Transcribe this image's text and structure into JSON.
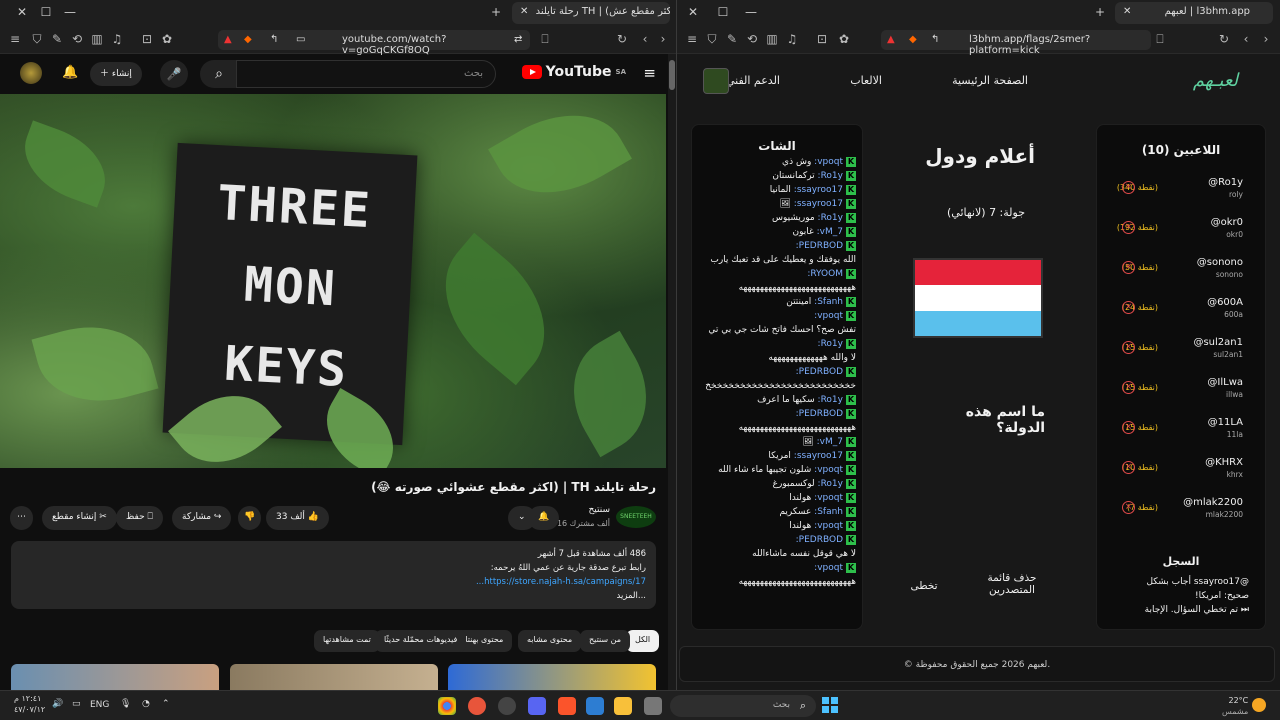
{
  "left_window": {
    "tab_title": "رحلة تايلند TH | (اكثر مقطع عش...",
    "url": "youtube.com/watch?v=goGqCKGf8OQ",
    "youtube": {
      "logo_text": "YouTube",
      "region": "SA",
      "search_placeholder": "بحث",
      "create_label": "إنشاء",
      "video": {
        "sign_lines": [
          "THREE",
          "MON",
          "KEYS"
        ],
        "title": "رحلة تايلند TH | (اكثر مقطع عشوائي صورته 😂)",
        "channel_name": "سنتيح",
        "channel_avatar_text": "SNEETEEH",
        "subscribers": "616 ألف مشترك",
        "likes": "33 ألف",
        "share_label": "مشاركة",
        "save_label": "حفظ",
        "clip_label": "إنشاء مقطع",
        "views_line": "486 ألف مشاهدة قبل 7 أشهر",
        "desc_line": "رابط تبرع صدقة جارية عن عمي اللهُ يرحمه:",
        "desc_link": "https://store.najah-h.sa/campaigns/17...",
        "more": "...المزيد"
      },
      "chips": [
        "الكل",
        "من سنتيح",
        "محتوى مشابه",
        "محتوى بهنتك",
        "فيديوهات محمّلة حديثًا",
        "تمت مشاهدتها"
      ]
    }
  },
  "right_window": {
    "tab_title": "لعبهم | l3bhm.app",
    "url": "l3bhm.app/flags/2smer?platform=kick",
    "app": {
      "logo": "لعبـهم",
      "nav": [
        "الصفحة الرئيسية",
        "الالعاب",
        "الدعم الفني"
      ],
      "players_title": "اللاعبين (10)",
      "players": [
        {
          "name": "@Ro1y",
          "handle": "roly",
          "points": "(340 نقطة)"
        },
        {
          "name": "@okr0",
          "handle": "okr0",
          "points": "(192 نقطة)"
        },
        {
          "name": "@sonono",
          "handle": "sonono",
          "points": "(50 نقطة)"
        },
        {
          "name": "@600A",
          "handle": "600a",
          "points": "(24 نقطة)"
        },
        {
          "name": "@sul2an1",
          "handle": "sul2an1",
          "points": "(15 نقطة)"
        },
        {
          "name": "@IlLwa",
          "handle": "illwa",
          "points": "(15 نقطة)"
        },
        {
          "name": "@11LA",
          "handle": "11la",
          "points": "(15 نقطة)"
        },
        {
          "name": "@KHRX",
          "handle": "khrx",
          "points": "(10 نقطة)"
        },
        {
          "name": "@mlak2200",
          "handle": "mlak2200",
          "points": "(7 نقطة)"
        }
      ],
      "log_title": "السجل",
      "log_lines": [
        "@ssayroo17 أجاب بشكل",
        "صحيح: امريكا!",
        "⏭ تم تخطي السؤال. الإجابة"
      ],
      "game_title": "أعلام ودول",
      "round": "جولة: 7 (لانهائي)",
      "flag_colors": [
        "#e5233a",
        "#ffffff",
        "#5ac0ec"
      ],
      "question": "ما اسم هذه الدولة؟",
      "leaderboard_button": "حذف قائمة المتصدرين",
      "skip_button": "تخطى",
      "chat_title": "الشات",
      "chat": [
        {
          "user": "vpoqt:",
          "text": "وش ذي"
        },
        {
          "user": "Ro1y:",
          "text": "تركمانستان"
        },
        {
          "user": "ssayroo17:",
          "text": "المانيا"
        },
        {
          "user": "ssayroo17:",
          "text": "🖼"
        },
        {
          "user": "Ro1y:",
          "text": "موريشيوس"
        },
        {
          "user": "vM_7:",
          "text": "غابون"
        },
        {
          "user": "PEDRBOD:",
          "text": ""
        },
        {
          "user": "",
          "text": "الله يوفقك و يعطيك على قد تعبك يارب"
        },
        {
          "user": "RYOOM:",
          "text": ""
        },
        {
          "user": "",
          "text": "هههههههههههههههههههههههههههه"
        },
        {
          "user": "Sfanh:",
          "text": "امينتتن"
        },
        {
          "user": "vpoqt:",
          "text": ""
        },
        {
          "user": "",
          "text": "تفش صح؟ احسك فاتح شات جي بي تي"
        },
        {
          "user": "Ro1y:",
          "text": ""
        },
        {
          "user": "",
          "text": "لا والله هههههههههههههه"
        },
        {
          "user": "PEDRBOD:",
          "text": ""
        },
        {
          "user": "",
          "text": "خخخخخخخخخخخخخخخخخخخخخخخخخخ"
        },
        {
          "user": "Ro1y:",
          "text": "سكيها ما اعرف"
        },
        {
          "user": "PEDRBOD:",
          "text": ""
        },
        {
          "user": "",
          "text": "هههههههههههههههههههههههههههه"
        },
        {
          "user": "vM_7:",
          "text": "🖼"
        },
        {
          "user": "ssayroo17:",
          "text": "امريكا"
        },
        {
          "user": "vpoqt:",
          "text": "شلون تجيبها ماء شاء الله"
        },
        {
          "user": "Ro1y:",
          "text": "لوكسمبورغ"
        },
        {
          "user": "vpoqt:",
          "text": "هولندا"
        },
        {
          "user": "Sfanh:",
          "text": "عسكريم"
        },
        {
          "user": "vpoqt:",
          "text": "هولندا"
        },
        {
          "user": "PEDRBOD:",
          "text": ""
        },
        {
          "user": "",
          "text": "لا هي قوقل نفسه ماشاءالله"
        },
        {
          "user": "vpoqt:",
          "text": ""
        },
        {
          "user": "",
          "text": "هههههههههههههههههههههههههههه"
        }
      ],
      "footer": "© لعبهم 2026 جميع الحقوق محفوظة."
    }
  },
  "taskbar": {
    "search_placeholder": "بحث",
    "weather_temp": "22°C",
    "weather_desc": "مشمس",
    "lang": "ENG",
    "time": "١٢:٤١ م",
    "date": "٤٧/٠٧/١٢"
  }
}
